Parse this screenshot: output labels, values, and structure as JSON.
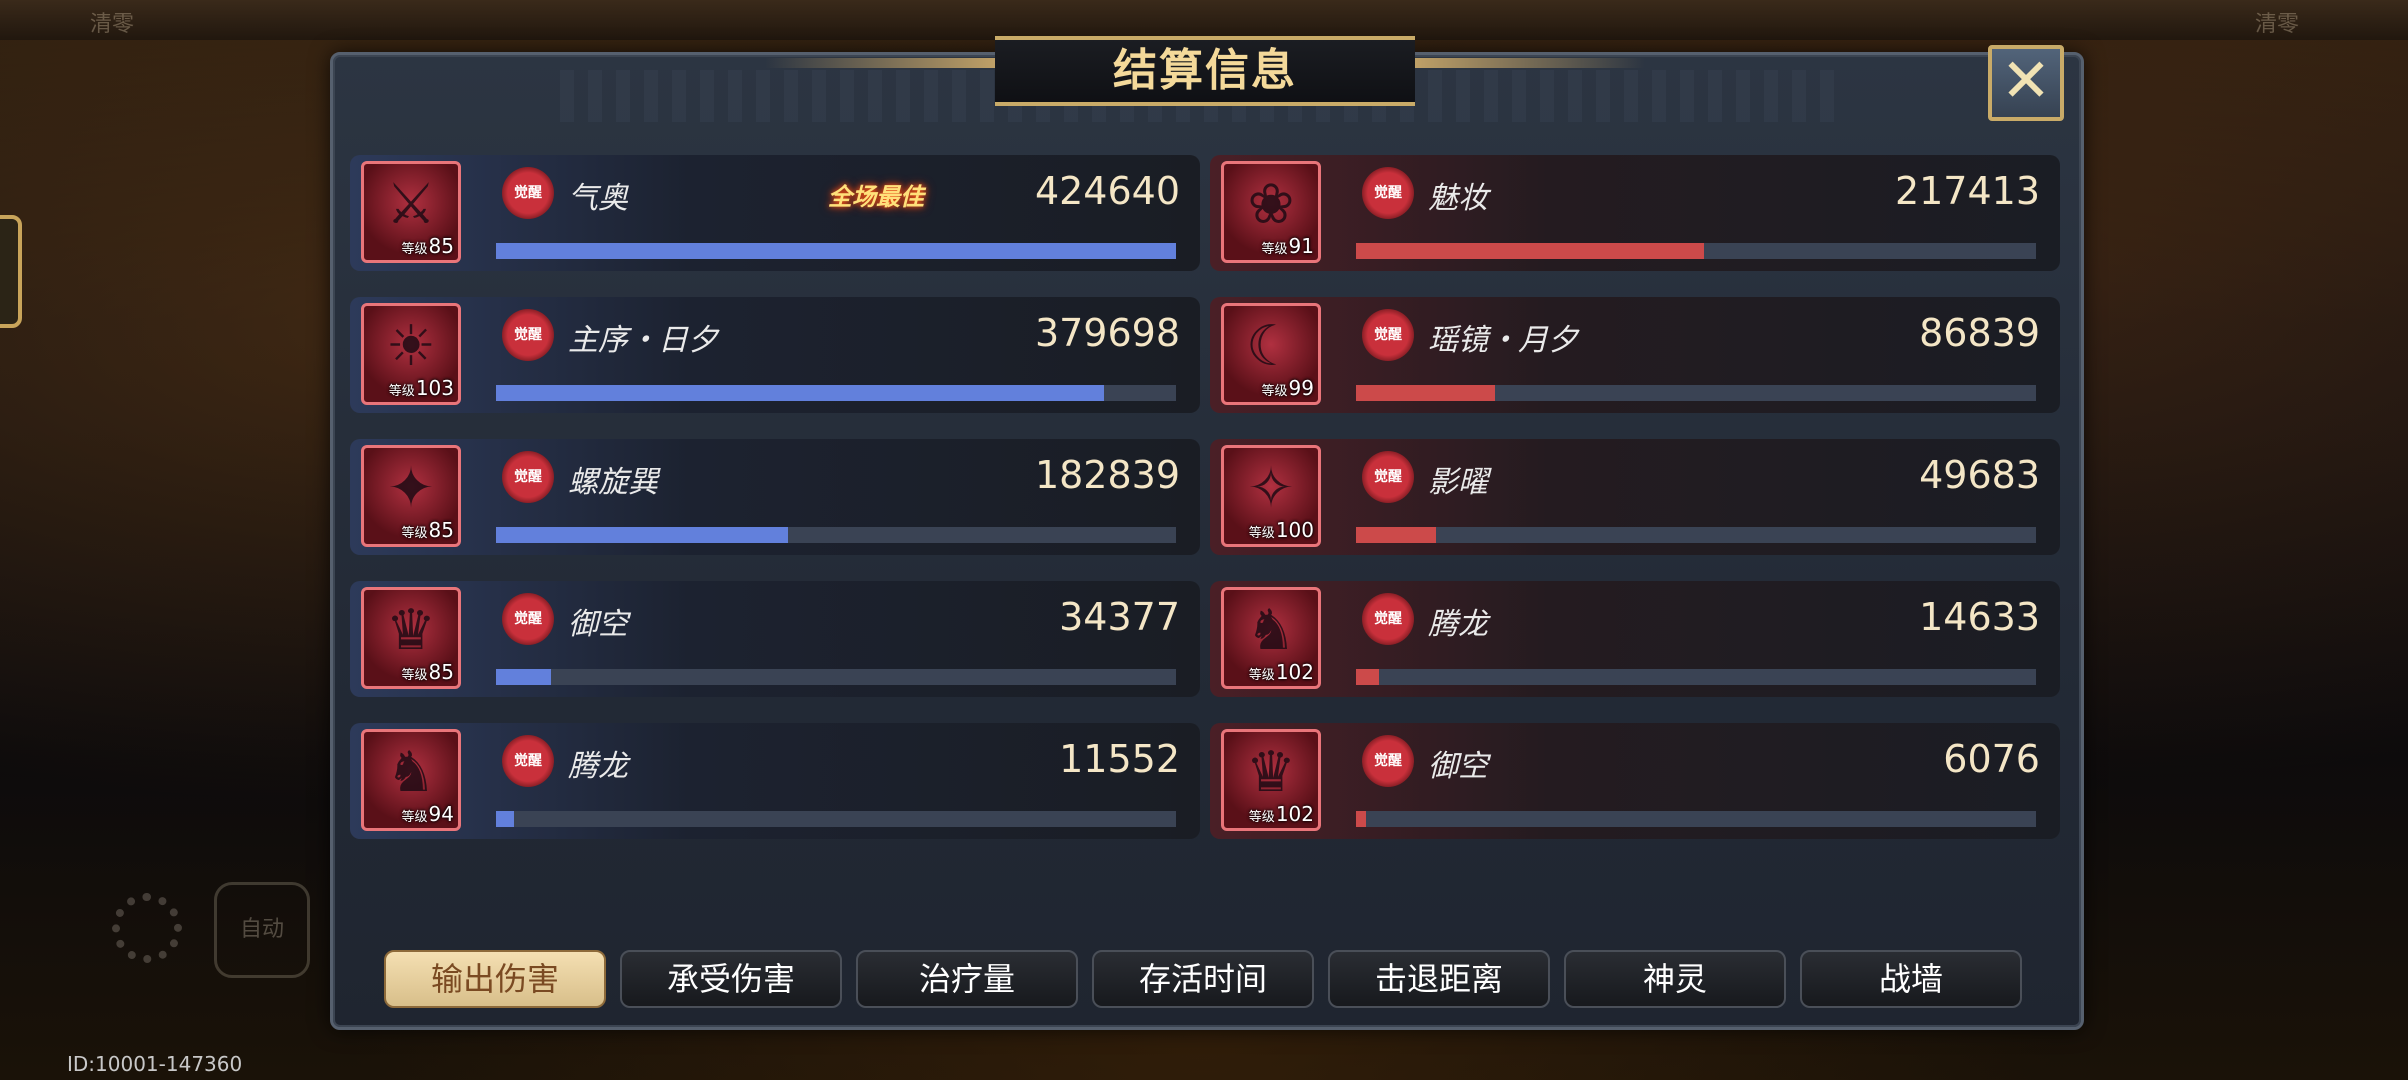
{
  "background": {
    "top_left_label": "清零",
    "top_right_label": "清零",
    "auto_button_label": "自动",
    "id_text": "ID:10001-147360"
  },
  "header": {
    "title": "结算信息"
  },
  "best_tag": "全场最佳",
  "left_team": [
    {
      "name": "气奥",
      "value": "424640",
      "level": "85",
      "badge": "觉醒",
      "fill": 1.0,
      "best": true,
      "glyph": "⚔"
    },
    {
      "name": "主序・日夕",
      "value": "379698",
      "level": "103",
      "badge": "觉醒",
      "fill": 0.894,
      "glyph": "☀"
    },
    {
      "name": "螺旋巽",
      "value": "182839",
      "level": "85",
      "badge": "觉醒",
      "fill": 0.43,
      "glyph": "✦"
    },
    {
      "name": "御空",
      "value": "34377",
      "level": "85",
      "badge": "觉醒",
      "fill": 0.081,
      "glyph": "♛"
    },
    {
      "name": "腾龙",
      "value": "11552",
      "level": "94",
      "badge": "觉醒",
      "fill": 0.027,
      "glyph": "♞"
    }
  ],
  "right_team": [
    {
      "name": "魅妆",
      "value": "217413",
      "level": "91",
      "badge": "觉醒",
      "fill": 0.512,
      "glyph": "❀"
    },
    {
      "name": "瑶镜・月夕",
      "value": "86839",
      "level": "99",
      "badge": "觉醒",
      "fill": 0.204,
      "glyph": "☾"
    },
    {
      "name": "影曜",
      "value": "49683",
      "level": "100",
      "badge": "觉醒",
      "fill": 0.117,
      "glyph": "✧"
    },
    {
      "name": "腾龙",
      "value": "14633",
      "level": "102",
      "badge": "觉醒",
      "fill": 0.034,
      "glyph": "♞"
    },
    {
      "name": "御空",
      "value": "6076",
      "level": "102",
      "badge": "觉醒",
      "fill": 0.014,
      "glyph": "♛"
    }
  ],
  "level_prefix": "等级",
  "tabs": [
    {
      "label": "输出伤害",
      "active": true
    },
    {
      "label": "承受伤害",
      "active": false
    },
    {
      "label": "治疗量",
      "active": false
    },
    {
      "label": "存活时间",
      "active": false
    },
    {
      "label": "击退距离",
      "active": false
    },
    {
      "label": "神灵",
      "active": false
    },
    {
      "label": "战墙",
      "active": false
    }
  ],
  "colors": {
    "left_bar": "#6280dc",
    "right_bar": "#cc4a4a",
    "title": "#f4d99a",
    "active_tab": "#d8bf8a"
  },
  "icons": {
    "close": "close-icon",
    "settings": "gear-icon",
    "best_flame": "flame-icon"
  }
}
